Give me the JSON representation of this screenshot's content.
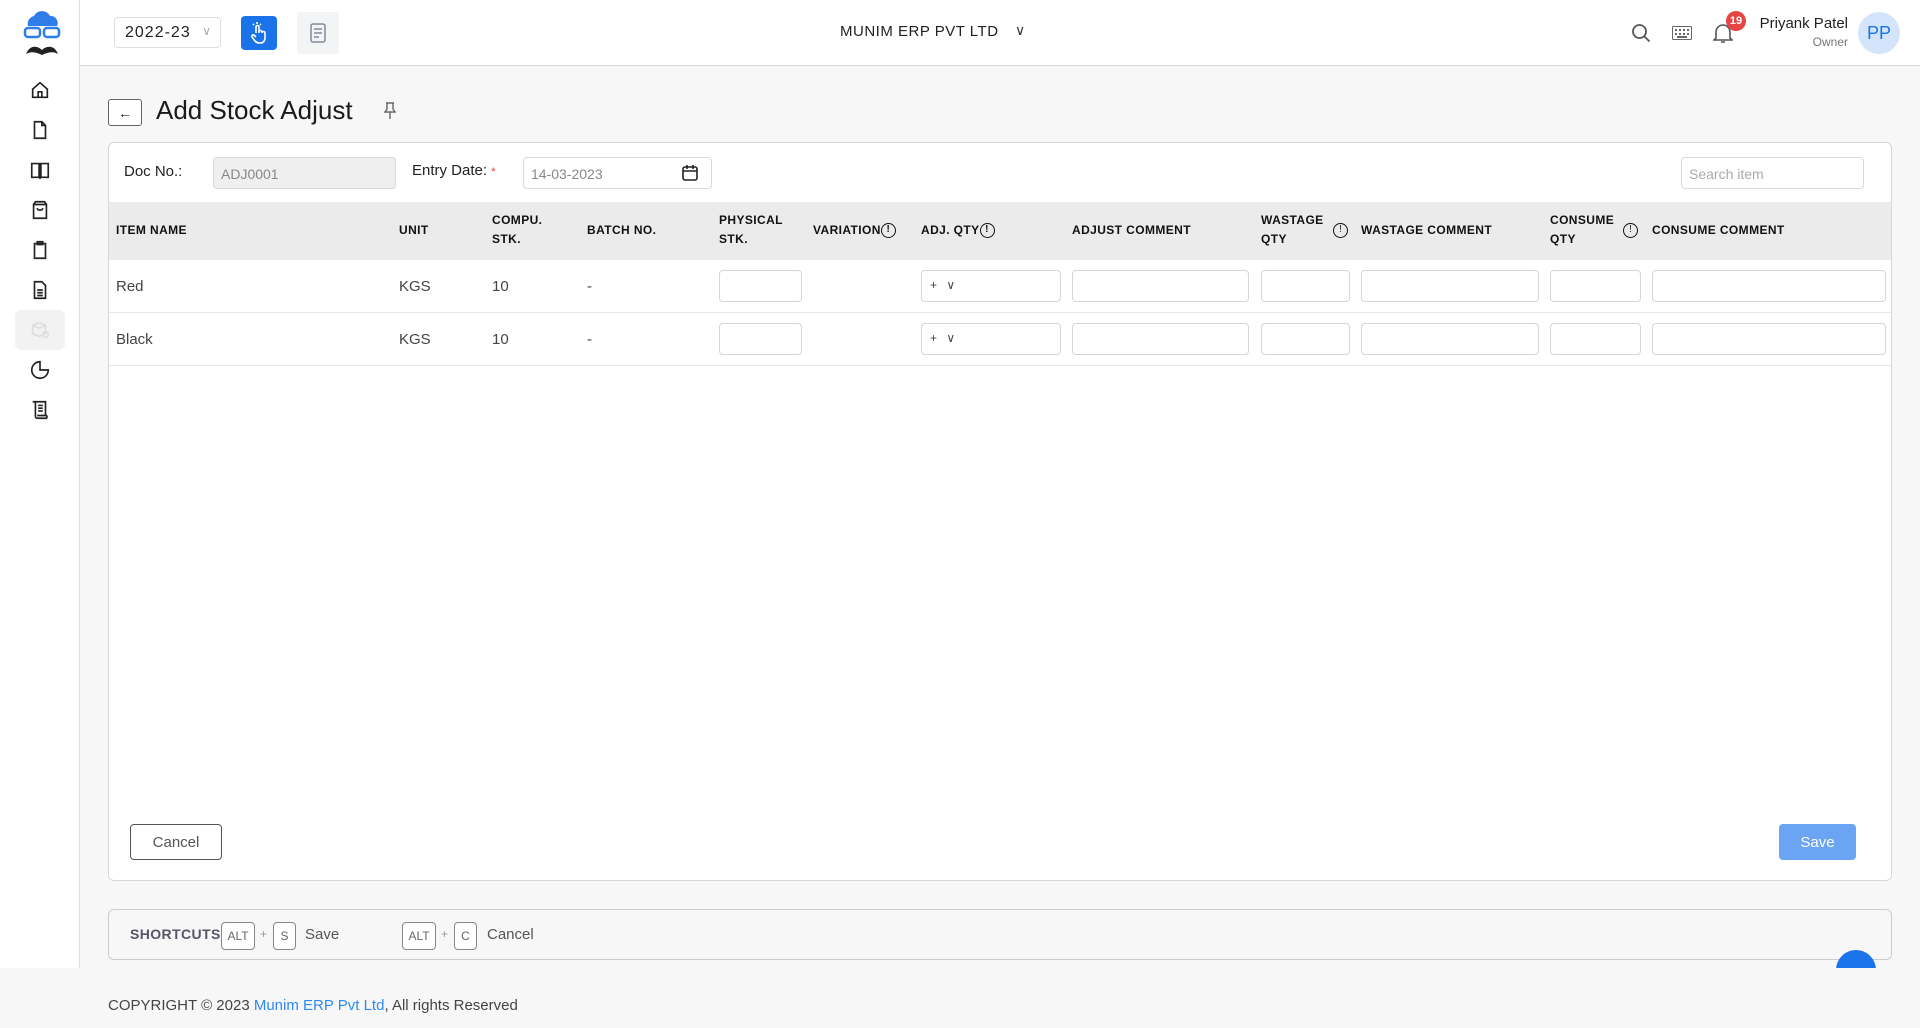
{
  "topbar": {
    "year": "2022-23",
    "company": "MUNIM ERP PVT LTD",
    "user_name": "Priyank Patel",
    "user_role": "Owner",
    "avatar_initials": "PP",
    "notifications": "19"
  },
  "sidebar": {
    "items": [
      "home",
      "document",
      "book",
      "shopping-bag",
      "clipboard",
      "file-text",
      "stock-adjust",
      "pie-chart",
      "scroll"
    ],
    "active": "stock-adjust"
  },
  "page": {
    "title": "Add Stock Adjust"
  },
  "form": {
    "doc_no_label": "Doc No.:",
    "doc_no_value": "ADJ0001",
    "entry_date_label": "Entry Date:",
    "required_mark": "*",
    "entry_date_value": "14-03-2023",
    "search_placeholder": "Search item"
  },
  "table": {
    "headers": {
      "item_name": "ITEM NAME",
      "unit": "UNIT",
      "compu_stk_1": "COMPU.",
      "compu_stk_2": "STK.",
      "batch_no": "BATCH NO.",
      "physical_stk_1": "PHYSICAL",
      "physical_stk_2": "STK.",
      "variation": "VARIATION",
      "adj_qty": "ADJ. QTY",
      "adjust_comment": "ADJUST COMMENT",
      "wastage_qty_1": "WASTAGE",
      "wastage_qty_2": "QTY",
      "wastage_comment": "WASTAGE COMMENT",
      "consume_qty_1": "CONSUME",
      "consume_qty_2": "QTY",
      "consume_comment": "CONSUME COMMENT"
    },
    "rows": [
      {
        "item_name": "Red",
        "unit": "KGS",
        "compu_stk": "10",
        "batch_no": "-",
        "adj_sign": "+"
      },
      {
        "item_name": "Black",
        "unit": "KGS",
        "compu_stk": "10",
        "batch_no": "-",
        "adj_sign": "+"
      }
    ]
  },
  "actions": {
    "cancel": "Cancel",
    "save": "Save"
  },
  "shortcuts": {
    "label": "SHORTCUTS:",
    "alt": "ALT",
    "plus": "+",
    "save_key": "S",
    "save_label": "Save",
    "cancel_key": "C",
    "cancel_label": "Cancel"
  },
  "footer": {
    "prefix": "COPYRIGHT © 2023 ",
    "link": "Munim ERP Pvt Ltd",
    "suffix": ", All rights Reserved"
  },
  "colors": {
    "primary": "#1a73e8",
    "save_button": "#6aa4f2",
    "badge": "#e64545"
  }
}
